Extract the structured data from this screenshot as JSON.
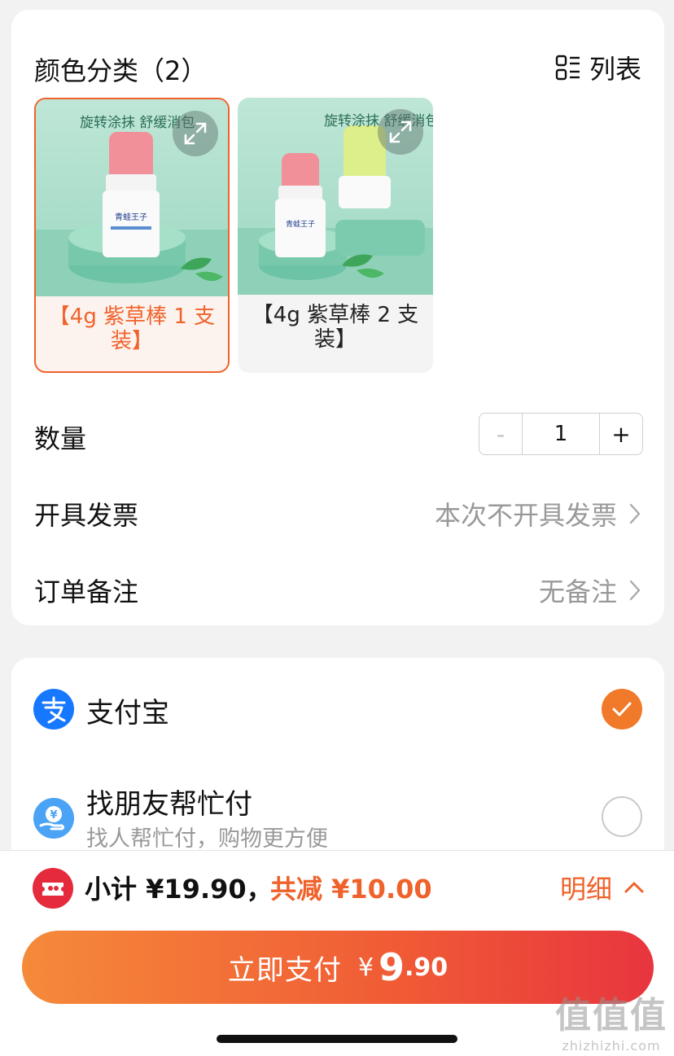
{
  "spec_section": {
    "title": "颜色分类（2）",
    "view_toggle_label": "列表",
    "skus": [
      {
        "label": "【4g 紫草棒 1 支装】",
        "image_caption": "旋转涂抹 舒缓消包",
        "selected": true
      },
      {
        "label": "【4g 紫草棒 2 支装】",
        "image_caption": "旋转涂抹 舒缓消包",
        "selected": false
      }
    ]
  },
  "quantity": {
    "label": "数量",
    "minus": "-",
    "value": "1",
    "plus": "+"
  },
  "invoice": {
    "label": "开具发票",
    "value": "本次不开具发票"
  },
  "remark": {
    "label": "订单备注",
    "value": "无备注"
  },
  "payment": {
    "methods": [
      {
        "name": "支付宝",
        "subtitle": "",
        "icon": "alipay-icon",
        "selected": true
      },
      {
        "name": "找朋友帮忙付",
        "subtitle": "找人帮忙付，购物更方便",
        "icon": "friend-pay-icon",
        "selected": false
      }
    ]
  },
  "summary": {
    "subtotal": "小计 ¥19.90，",
    "discount": "共减 ¥10.00",
    "detail_label": "明细"
  },
  "pay_button": {
    "label": "立即支付",
    "currency": "¥",
    "amount_int": "9",
    "amount_dec": ".90"
  },
  "watermark": {
    "main": "值值值",
    "sub": "zhizhizhi.com"
  },
  "colors": {
    "accent": "#f0622b",
    "alipay_blue": "#1677ff",
    "coupon_red": "#e42a3b"
  }
}
